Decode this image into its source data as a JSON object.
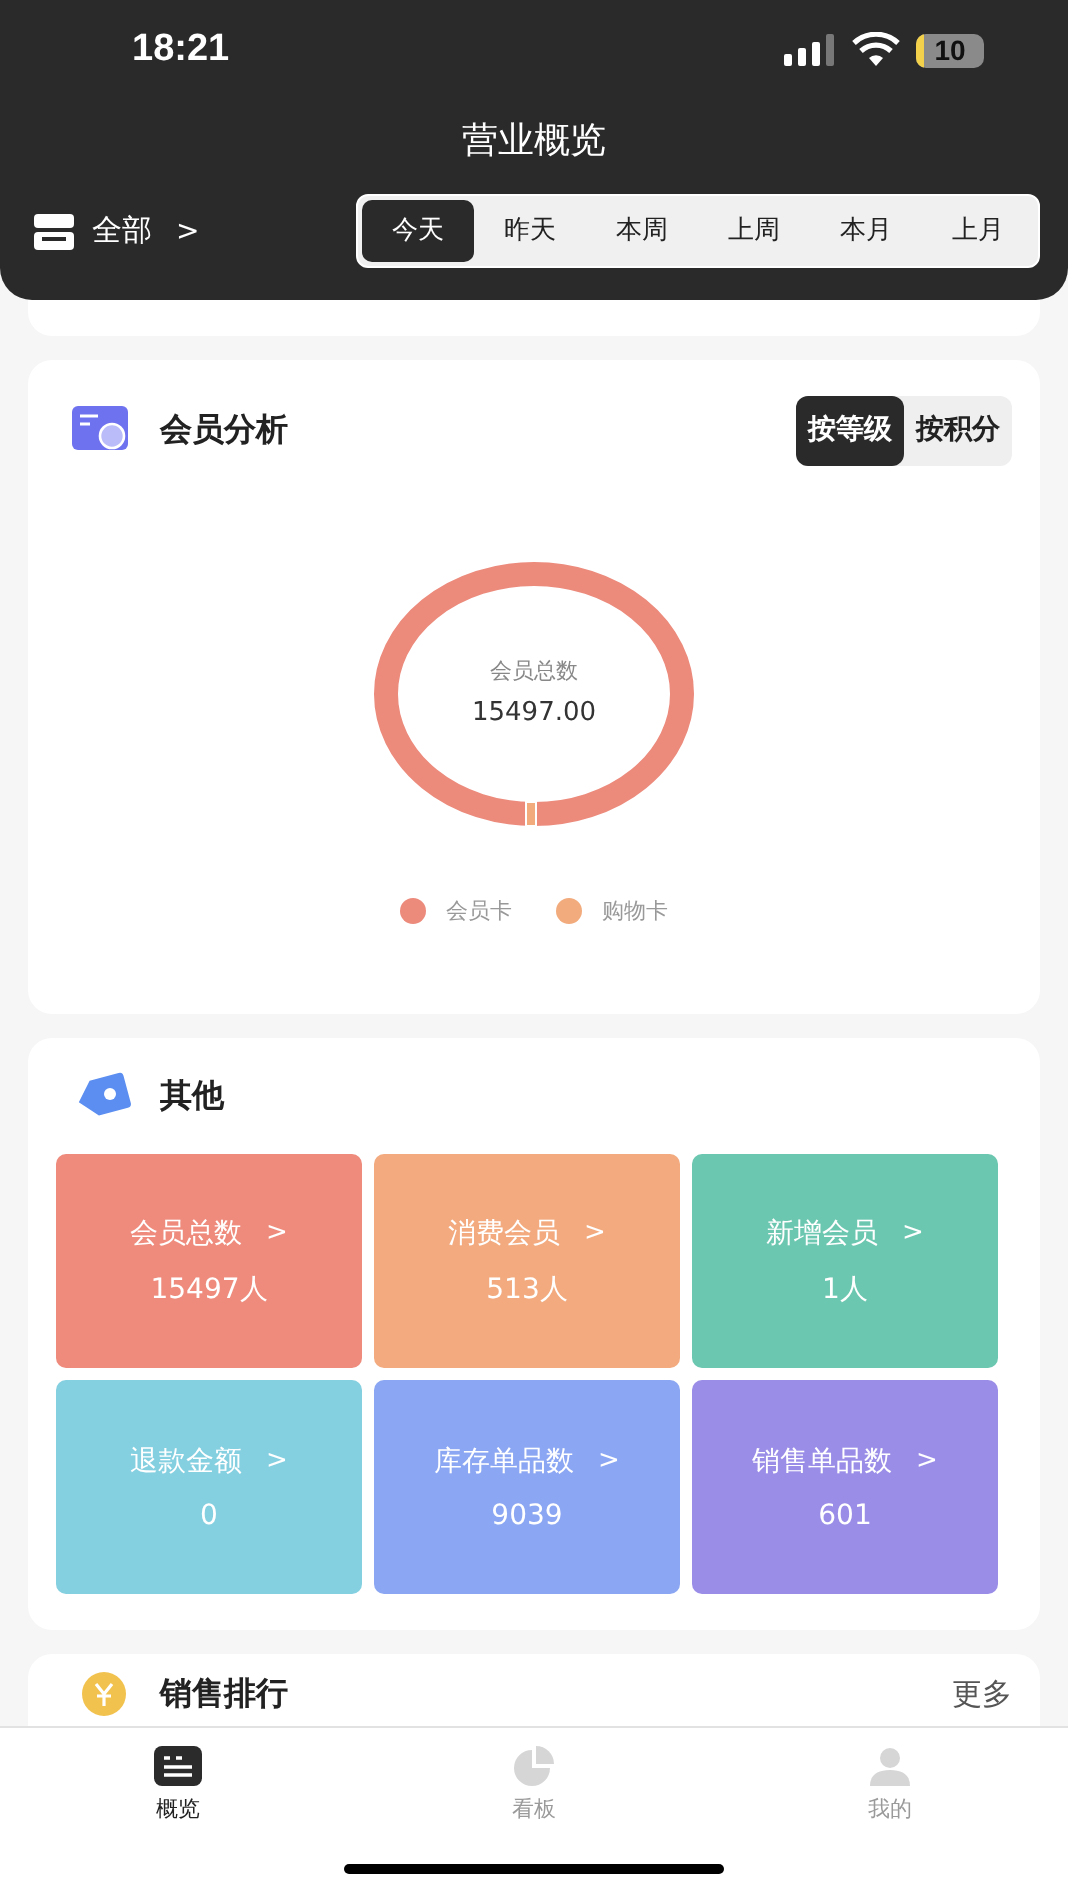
{
  "status_bar": {
    "time": "18:21",
    "battery": "10"
  },
  "header": {
    "title": "营业概览",
    "store": "全部",
    "store_caret": ">"
  },
  "period_tabs": [
    {
      "label": "今天",
      "selected": true
    },
    {
      "label": "昨天",
      "selected": false
    },
    {
      "label": "本周",
      "selected": false
    },
    {
      "label": "上周",
      "selected": false
    },
    {
      "label": "本月",
      "selected": false
    },
    {
      "label": "上月",
      "selected": false
    }
  ],
  "member_analysis": {
    "title": "会员分析",
    "toggle": [
      {
        "label": "按等级",
        "selected": true
      },
      {
        "label": "按积分",
        "selected": false
      }
    ],
    "center_label": "会员总数",
    "center_value": "15497.00",
    "legend": [
      {
        "label": "会员卡",
        "color": "#ec8a7c"
      },
      {
        "label": "购物卡",
        "color": "#f2ab7d"
      }
    ]
  },
  "other": {
    "title": "其他",
    "tiles": [
      {
        "label": "会员总数",
        "value": "15497人",
        "color": "#ee8b7c"
      },
      {
        "label": "消费会员",
        "value": "513人",
        "color": "#f2aa7e"
      },
      {
        "label": "新增会员",
        "value": "1人",
        "color": "#6cc7b0"
      },
      {
        "label": "退款金额",
        "value": "0",
        "color": "#84cfe0"
      },
      {
        "label": "库存单品数",
        "value": "9039",
        "color": "#8ba6f2"
      },
      {
        "label": "销售单品数",
        "value": "601",
        "color": "#9a8de8"
      }
    ],
    "tile_caret": ">"
  },
  "sales_ranking": {
    "title": "销售排行",
    "more": "更多"
  },
  "bottom_nav": [
    {
      "label": "概览",
      "kind": "list",
      "selected": true
    },
    {
      "label": "看板",
      "kind": "pie",
      "selected": false
    },
    {
      "label": "我的",
      "kind": "person",
      "selected": false
    }
  ]
}
